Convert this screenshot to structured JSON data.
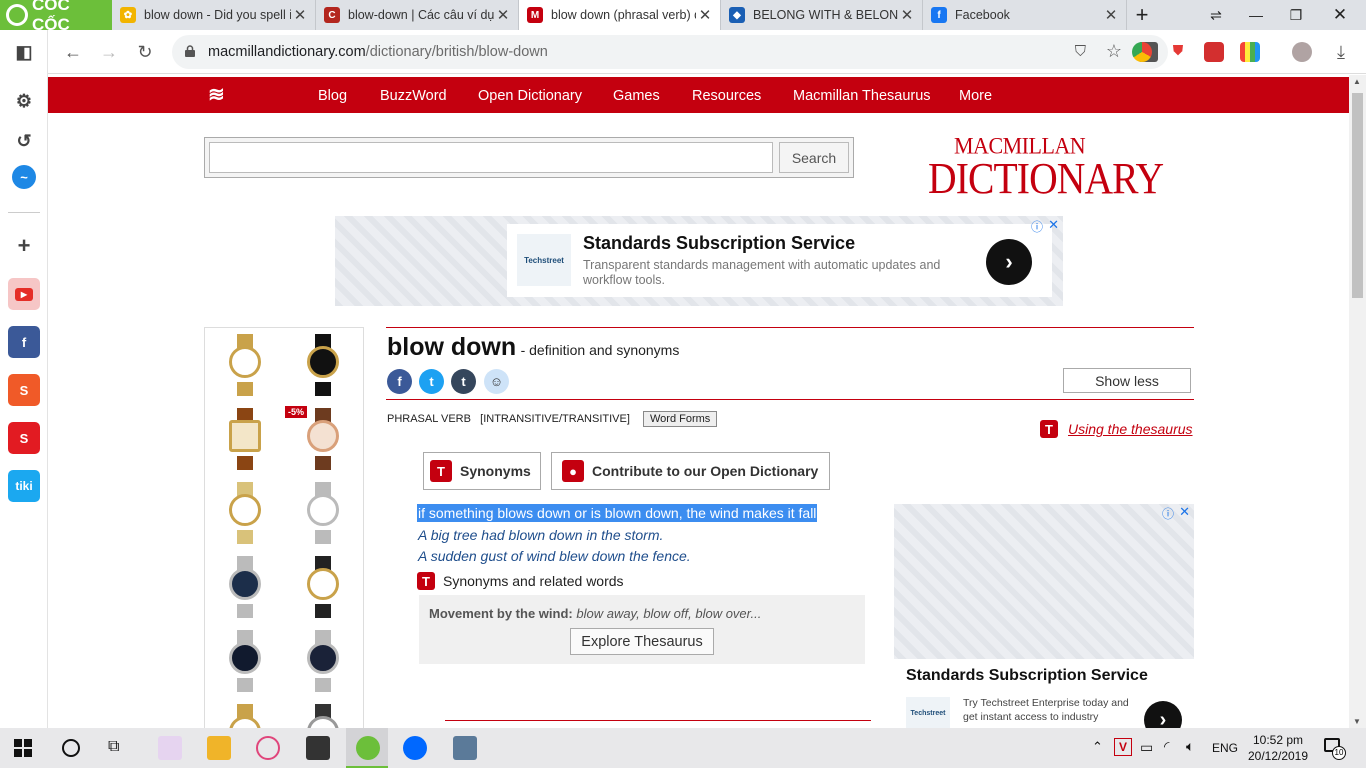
{
  "browser": {
    "brand": "CỐC CỐC",
    "tabs": [
      {
        "title": "blow down - Did you spell it"
      },
      {
        "title": "blow-down | Các câu ví dụ"
      },
      {
        "title": "blow down (phrasal verb) d"
      },
      {
        "title": "BELONG WITH & BELONG T"
      },
      {
        "title": "Facebook"
      }
    ],
    "url_domain": "macmillandictionary.com",
    "url_path": "/dictionary/british/blow-down"
  },
  "site": {
    "menu": [
      "Blog",
      "BuzzWord",
      "Open Dictionary",
      "Games",
      "Resources",
      "Macmillan Thesaurus",
      "More"
    ],
    "search_button": "Search",
    "logo_top": "MACMILLAN",
    "logo_bottom": "DICTIONARY"
  },
  "ad_top": {
    "title": "Standards Subscription Service",
    "desc": "Transparent standards management with automatic updates and workflow tools.",
    "brand": "Techstreet"
  },
  "ad_side": {
    "title": "Standards Subscription Service",
    "desc": "Try Techstreet Enterprise today and get instant access to industry",
    "brand": "Techstreet"
  },
  "watch_badge": "-5%",
  "entry": {
    "headword": "blow down",
    "subtitle": "- definition and synonyms",
    "show_less": "Show less",
    "pos": "PHRASAL VERB",
    "grammar": "[INTRANSITIVE/TRANSITIVE]",
    "word_forms": "Word Forms",
    "thesaurus_link": "Using the thesaurus",
    "synonyms_btn": "Synonyms",
    "contribute_btn": "Contribute to our Open Dictionary",
    "definition": "if something blows down or is blown down, the wind makes it fall",
    "examples": [
      "A big tree had blown down in the storm.",
      "A sudden gust of wind blew down the fence."
    ],
    "syn_heading": "Synonyms and related words",
    "syn_label": "Movement by the wind:",
    "syn_words": "blow away, blow off, blow over...",
    "explore_btn": "Explore Thesaurus"
  },
  "taskbar": {
    "lang": "ENG",
    "time": "10:52 pm",
    "date": "20/12/2019",
    "notif": "10"
  }
}
